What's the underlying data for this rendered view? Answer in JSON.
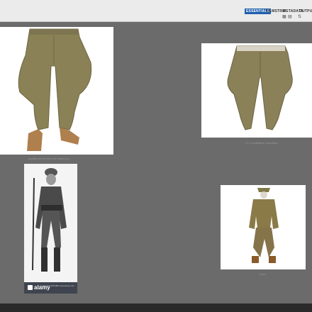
{
  "workspaces": [
    {
      "label": "ESSENTIALS",
      "active": true
    },
    {
      "label": "FILMSTRIP",
      "active": false
    },
    {
      "label": "METADATA",
      "active": false
    },
    {
      "label": "OUTPUT",
      "active": false
    }
  ],
  "toolbar_icons": [
    "grid-view-icon",
    "list-view-icon",
    "sort-icon"
  ],
  "images": [
    {
      "name": "riding-breeches-front",
      "caption": "pantalón de fiel nuevo de modelo u.p"
    },
    {
      "name": "breeches-back",
      "caption": "1 2 3 4 antipattern. description"
    },
    {
      "name": "soldier-photo",
      "caption": "",
      "watermark": "alamy",
      "stock_id": "Image ID: C0X4BK www.alamy.com"
    },
    {
      "name": "uniform-mannequin",
      "caption": "bosm"
    }
  ]
}
